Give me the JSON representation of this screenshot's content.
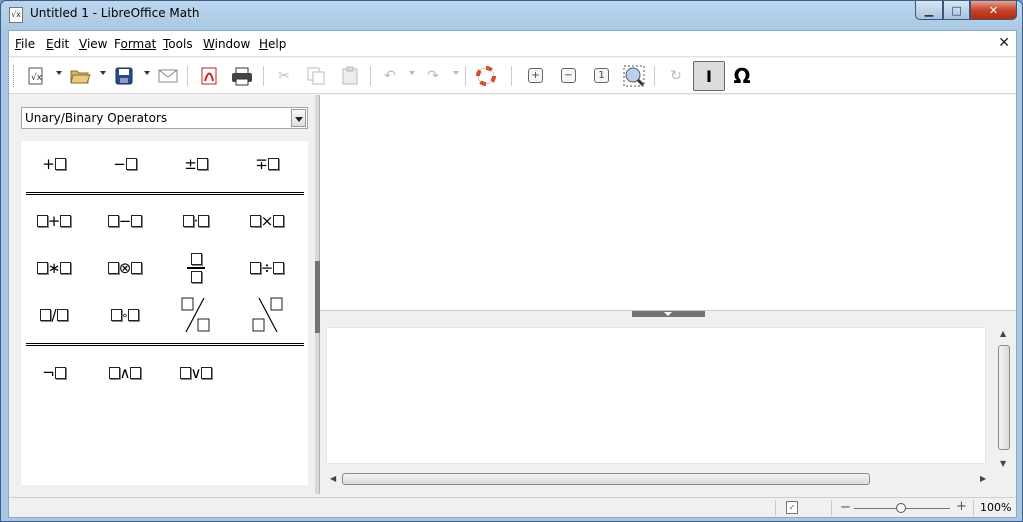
{
  "window": {
    "title": "Untitled 1 - LibreOffice Math",
    "app_icon": "math-formula-icon"
  },
  "menu": {
    "items": [
      {
        "label": "File",
        "mnemonic": "F",
        "rest": "ile"
      },
      {
        "label": "Edit",
        "mnemonic": "E",
        "rest": "dit"
      },
      {
        "label": "View",
        "mnemonic": "V",
        "rest": "iew"
      },
      {
        "label": "Format",
        "mnemonic": "F",
        "rest": "ormat",
        "pre": ""
      },
      {
        "label": "Tools",
        "mnemonic": "T",
        "rest": "ools"
      },
      {
        "label": "Window",
        "mnemonic": "W",
        "rest": "indow"
      },
      {
        "label": "Help",
        "mnemonic": "H",
        "rest": "elp"
      }
    ],
    "close_doc_glyph": "✕"
  },
  "toolbar": {
    "icons": [
      "new-icon",
      "open-icon",
      "save-icon",
      "email-icon",
      "export-pdf-icon",
      "print-icon",
      "cut-icon",
      "copy-icon",
      "paste-icon",
      "undo-icon",
      "redo-icon",
      "help-icon",
      "zoom-in-icon",
      "zoom-out-icon",
      "show-all-icon",
      "update-icon",
      "formula-cursor-icon",
      "symbols-icon"
    ],
    "cursor_glyph": "I",
    "omega_glyph": "Ω"
  },
  "elements": {
    "category": "Unary/Binary Operators",
    "unary": [
      "+",
      "−",
      "±",
      "∓"
    ],
    "binary_row1": [
      "+",
      "−",
      "·",
      "×"
    ],
    "binary_row2": [
      "∗",
      "⊗",
      "÷"
    ],
    "binary_row3": [
      "/",
      "∘"
    ],
    "logic": [
      "¬",
      "∧",
      "∨"
    ]
  },
  "statusbar": {
    "zoom": "100%",
    "zoom_minus": "−",
    "zoom_plus": "+",
    "zoom_level": 0.5
  }
}
